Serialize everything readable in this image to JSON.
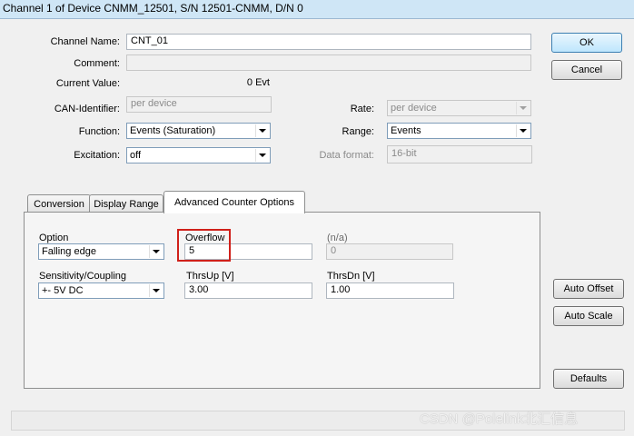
{
  "window": {
    "title": "Channel 1 of Device CNMM_12501, S/N 12501-CNMM, D/N 0"
  },
  "form": {
    "channel_name_label": "Channel Name:",
    "channel_name_value": "CNT_01",
    "comment_label": "Comment:",
    "comment_value": "",
    "current_value_label": "Current Value:",
    "current_value": "0 Evt",
    "can_identifier_label": "CAN-Identifier:",
    "can_identifier_value": "per device",
    "function_label": "Function:",
    "function_value": "Events (Saturation)",
    "excitation_label": "Excitation:",
    "excitation_value": "off",
    "rate_label": "Rate:",
    "rate_value": "per device",
    "range_label": "Range:",
    "range_value": "Events",
    "data_format_label": "Data format:",
    "data_format_value": "16-bit"
  },
  "buttons": {
    "ok": "OK",
    "cancel": "Cancel",
    "auto_offset": "Auto Offset",
    "auto_scale": "Auto Scale",
    "defaults": "Defaults"
  },
  "tabs": [
    {
      "label": "Conversion"
    },
    {
      "label": "Display Range"
    },
    {
      "label": "Advanced Counter Options"
    }
  ],
  "advanced": {
    "option_label": "Option",
    "option_value": "Falling edge",
    "overflow_label": "Overflow",
    "overflow_value": "5",
    "na_label": "(n/a)",
    "na_value": "0",
    "sensitivity_label": "Sensitivity/Coupling",
    "sensitivity_value": "+- 5V  DC",
    "thrsup_label": "ThrsUp [V]",
    "thrsup_value": "3.00",
    "thrsdn_label": "ThrsDn [V]",
    "thrsdn_value": "1.00"
  },
  "watermark": "CSDN @Polelink北汇信息",
  "colors": {
    "highlight": "#d0201a",
    "title_bar": "#cfe6f6",
    "default_button": "#bee6fd"
  }
}
